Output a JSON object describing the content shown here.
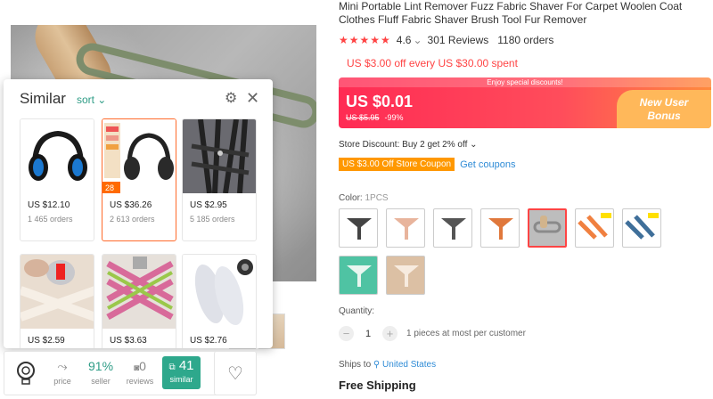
{
  "product": {
    "title": "Mini Portable Lint Remover Fuzz Fabric Shaver For Carpet Woolen Coat Clothes Fluff Fabric Shaver Brush Tool Fur Remover",
    "rating": "4.6",
    "reviews": "301 Reviews",
    "orders": "1180 orders",
    "promo": "US $3.00 off every US $30.00 spent",
    "banner_top": "Enjoy special discounts!",
    "price": "US $0.01",
    "orig_price": "US $5.95",
    "discount": "-99%",
    "bonus_line1": "New User",
    "bonus_line2": "Bonus",
    "store_discount": "Store Discount: Buy 2 get 2% off",
    "coupon": "US $3.00 Off Store Coupon",
    "get_coupons": "Get coupons",
    "color_label": "Color:",
    "color_value": "1PCS",
    "qty_label": "Quantity:",
    "qty_value": "1",
    "qty_note": "1 pieces at most per customer",
    "ships_label": "Ships to",
    "ships_to": "United States",
    "free_shipping": "Free Shipping"
  },
  "similar": {
    "title": "Similar",
    "sort": "sort",
    "items": [
      {
        "price": "US $12.10",
        "orders": "1 465 orders"
      },
      {
        "price": "US $36.26",
        "orders": "2 613 orders",
        "badge": "28"
      },
      {
        "price": "US $2.95",
        "orders": "5 185 orders"
      },
      {
        "price": "US $2.59",
        "orders": ""
      },
      {
        "price": "US $3.63",
        "orders": ""
      },
      {
        "price": "US $2.76",
        "orders": ""
      }
    ]
  },
  "toolbar": {
    "price_label": "price",
    "seller_pct": "91",
    "seller_label": "seller",
    "reviews_count": "0",
    "reviews_label": "reviews",
    "similar_count": "41",
    "similar_label": "similar"
  },
  "colors": {
    "accent": "#ff4747",
    "green": "#2ea88c",
    "link": "#2e8bd6"
  }
}
